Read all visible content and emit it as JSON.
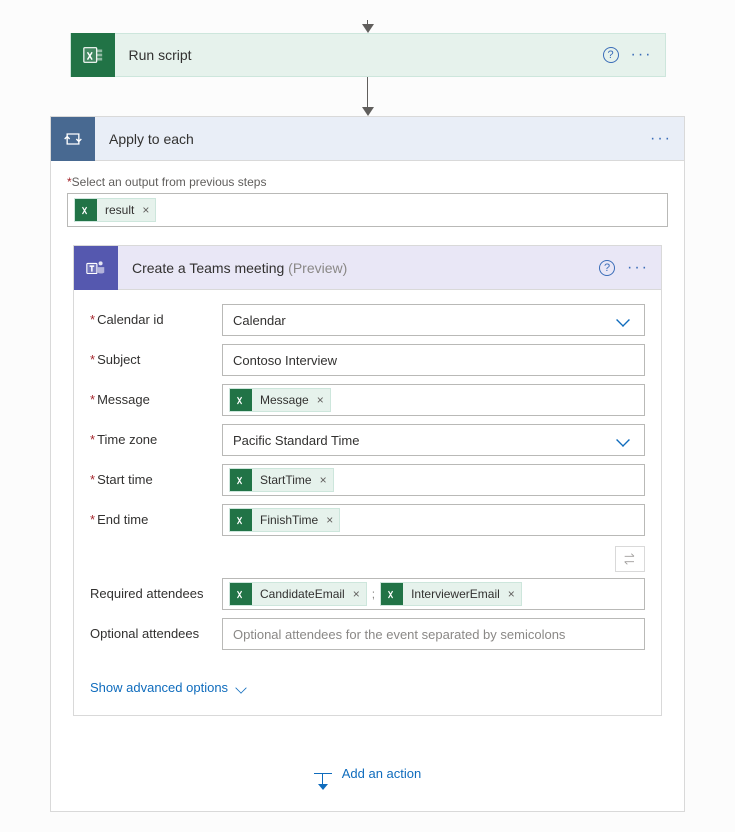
{
  "runScript": {
    "title": "Run script"
  },
  "loop": {
    "title": "Apply to each",
    "selectOutputLabel": "Select an output from previous steps",
    "outputToken": "result"
  },
  "teamsAction": {
    "title": "Create a Teams meeting",
    "previewTag": "(Preview)",
    "fields": {
      "calendarId": {
        "label": "Calendar id",
        "value": "Calendar"
      },
      "subject": {
        "label": "Subject",
        "value": "Contoso Interview"
      },
      "message": {
        "label": "Message",
        "token": "Message"
      },
      "timeZone": {
        "label": "Time zone",
        "value": "Pacific Standard Time"
      },
      "startTime": {
        "label": "Start time",
        "token": "StartTime"
      },
      "endTime": {
        "label": "End time",
        "token": "FinishTime"
      },
      "requiredAttendees": {
        "label": "Required attendees",
        "tokens": [
          "CandidateEmail",
          "InterviewerEmail"
        ]
      },
      "optionalAttendees": {
        "label": "Optional attendees",
        "placeholder": "Optional attendees for the event separated by semicolons"
      }
    },
    "advancedOptionsLabel": "Show advanced options",
    "addActionLabel": "Add an action"
  }
}
